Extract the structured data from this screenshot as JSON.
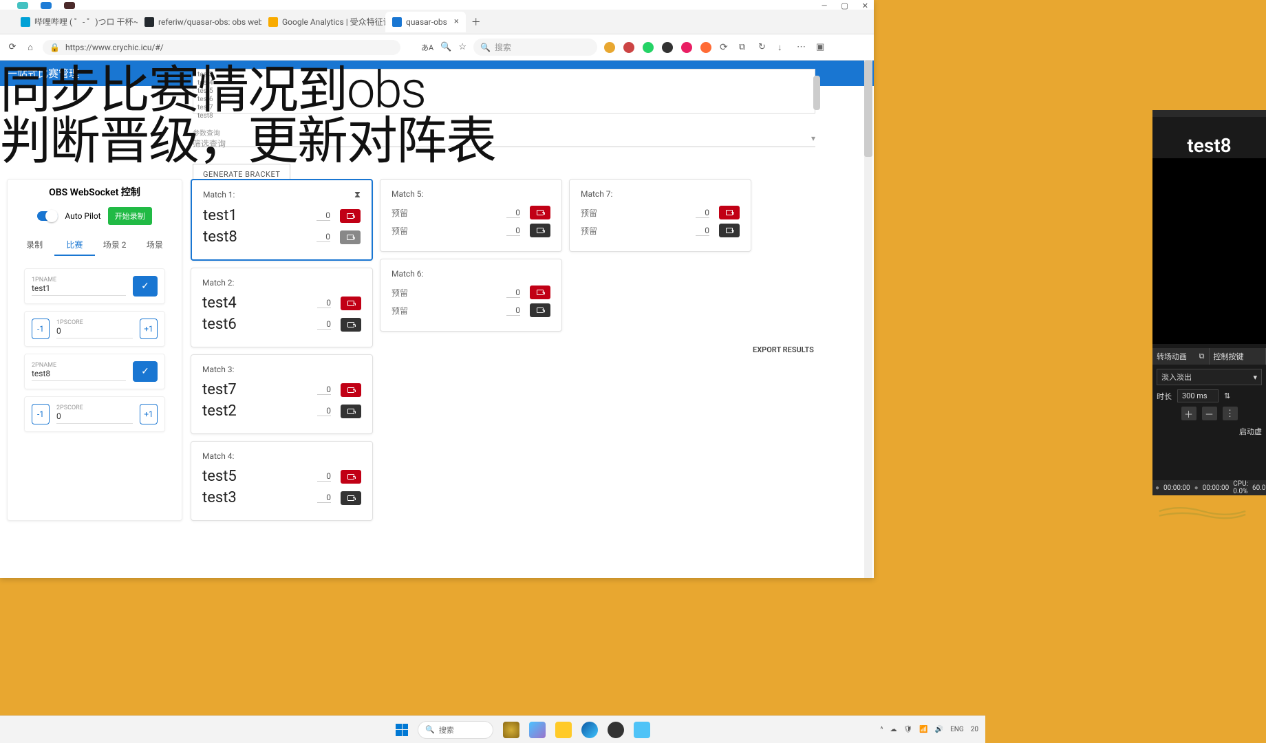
{
  "browser": {
    "tabs": [
      {
        "title": "哔哩哔哩 ( ゜- ゜)つロ 干杯~-bilib",
        "fav": "#00a1d6"
      },
      {
        "title": "referiw/quasar-obs: obs web con",
        "fav": "#24292e"
      },
      {
        "title": "Google Analytics | 受众特征详情",
        "fav": "#f9ab00"
      },
      {
        "title": "quasar-obs",
        "fav": "#1976d2",
        "active": true
      }
    ],
    "url": "https://www.crychic.icu/#/",
    "search_placeholder": "搜索",
    "new_tab": "＋",
    "win_min": "—",
    "win_max": "▢",
    "win_close": "✕"
  },
  "page": {
    "banner": "一站式比赛管理",
    "overlay_line1": "同步比赛情况到obs",
    "overlay_line2": "判断晋级，更新对阵表",
    "textarea_lines": "test3\ntest4\ntest5\ntest6\ntest7\ntest8",
    "dropdown_label": "参数查询",
    "dropdown_sub": "筛选查询",
    "generate_btn": "GENERATE BRACKET"
  },
  "sidebar": {
    "title": "OBS WebSocket 控制",
    "autopilot": "Auto Pilot",
    "record_btn": "开始录制",
    "tabs": [
      "录制",
      "比赛",
      "场景 2",
      "场景"
    ],
    "active_tab": 1,
    "p1_label": "1PNAME",
    "p1_name": "test1",
    "p1_score_label": "1PSCORE",
    "p1_score": "0",
    "p2_label": "2PNAME",
    "p2_name": "test8",
    "p2_score_label": "2PSCORE",
    "p2_score": "0",
    "minus": "-1",
    "plus": "+1"
  },
  "bracket": {
    "export": "EXPORT RESULTS",
    "reserved": "预留",
    "cols": [
      [
        {
          "title": "Match 1:",
          "sel": true,
          "hourglass": true,
          "p1": "test1",
          "s1": "0",
          "p2": "test8",
          "s2": "0",
          "big": true,
          "btn2": "gray"
        },
        {
          "title": "Match 2:",
          "p1": "test4",
          "s1": "0",
          "p2": "test6",
          "s2": "0",
          "big": true
        },
        {
          "title": "Match 3:",
          "p1": "test7",
          "s1": "0",
          "p2": "test2",
          "s2": "0",
          "big": true
        },
        {
          "title": "Match 4:",
          "p1": "test5",
          "s1": "0",
          "p2": "test3",
          "s2": "0",
          "big": true
        }
      ],
      [
        {
          "title": "Match 5:",
          "p1": "预留",
          "s1": "0",
          "p2": "预留",
          "s2": "0"
        },
        {
          "title": "Match 6:",
          "p1": "预留",
          "s1": "0",
          "p2": "预留",
          "s2": "0"
        }
      ],
      [
        {
          "title": "Match 7:",
          "p1": "预留",
          "s1": "0",
          "p2": "预留",
          "s2": "0"
        }
      ]
    ]
  },
  "obs": {
    "player": "test8",
    "tab1": "转场动画",
    "tab2": "控制按键",
    "transition": "淡入淡出",
    "duration_label": "时长",
    "duration": "300 ms",
    "launch": "启动虚",
    "time1": "00:00:00",
    "time2": "00:00:00",
    "cpu": "CPU: 0.0%",
    "fps": "60.0"
  },
  "taskbar": {
    "search": "搜索",
    "lang": "ENG",
    "time": "20",
    "sig": "〇"
  }
}
